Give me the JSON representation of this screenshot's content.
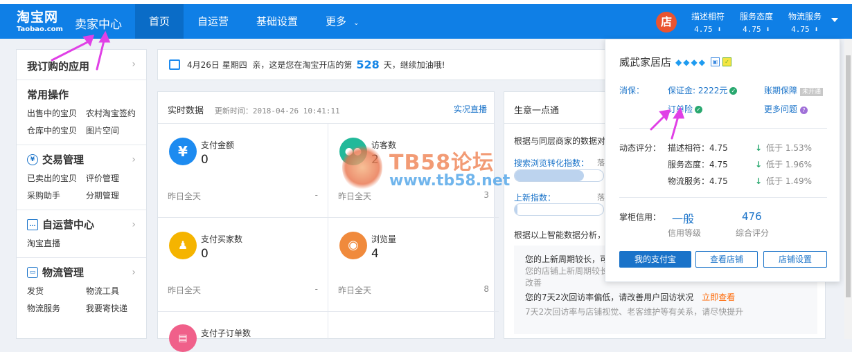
{
  "header": {
    "logo_main": "淘宝网",
    "logo_sub": "Taobao.com",
    "seller_center": "卖家中心",
    "nav": [
      "首页",
      "自运营",
      "基础设置",
      "更多"
    ],
    "shop_avatar": "店",
    "ratings": [
      {
        "label": "描述相符",
        "value": "4.75 ⬇"
      },
      {
        "label": "服务态度",
        "value": "4.75 ⬇"
      },
      {
        "label": "物流服务",
        "value": "4.75 ⬇"
      }
    ]
  },
  "sidebar": {
    "my_apps": "我订购的应用",
    "common_ops": {
      "title": "常用操作",
      "links": [
        "出售中的宝贝",
        "农村淘宝签约",
        "仓库中的宝贝",
        "图片空间"
      ]
    },
    "trade": {
      "title": "交易管理",
      "links": [
        "已卖出的宝贝",
        "评价管理",
        "采购助手",
        "分期管理"
      ]
    },
    "self_ops": {
      "title": "自运营中心",
      "links": [
        "淘宝直播"
      ]
    },
    "logistics": {
      "title": "物流管理",
      "links": [
        "发货",
        "物流工具",
        "物流服务",
        "我要寄快递"
      ]
    }
  },
  "notice": {
    "date": "4月26日 星期四",
    "text_before": "亲，这是您在淘宝开店的第",
    "days": "528",
    "text_after": "天，继续加油哦!"
  },
  "realtime": {
    "title": "实时数据",
    "update_time": "更新时间：2018-04-26 10:41:11",
    "live_link": "实况直播",
    "yesterday_label": "昨日全天",
    "cards": [
      {
        "label": "支付金额",
        "value": "0",
        "yesterday": "-",
        "icon": "¥",
        "color": "#1d8bf0"
      },
      {
        "label": "访客数",
        "value": "2",
        "yesterday": "3",
        "icon": "visitors-icon",
        "color": "#22b99a"
      },
      {
        "label": "支付买家数",
        "value": "0",
        "yesterday": "-",
        "icon": "buyer-icon",
        "color": "#f5b400"
      },
      {
        "label": "浏览量",
        "value": "4",
        "yesterday": "8",
        "icon": "eye-icon",
        "color": "#f08a3c"
      },
      {
        "label": "支付子订单数",
        "value": "",
        "yesterday": "",
        "icon": "order-icon",
        "color": "#f0608a"
      }
    ]
  },
  "business": {
    "title": "生意一点通",
    "compare_text": "根据与同层商家的数据对",
    "search_index": "搜索浏览转化指数：",
    "new_index": "上新指数：",
    "bar_tag": "落",
    "search_level": 0.78,
    "new_level": 0.03,
    "advice_text": "根据以上智能数据分析，",
    "tips": [
      "您的上新周期较长，可",
      "您的店铺上新周期较长",
      "改善",
      "您的7天2次回访率偏低，请改善用户回访状况",
      "立即查看",
      "7天2次回访率与店铺视觉、老客维护等有关系，请尽快提升"
    ]
  },
  "popup": {
    "shop_name": "威武家居店",
    "consumer_protection": "消保：",
    "deposit": "保证金: 2222元",
    "account_guarantee": "账期保障",
    "not_open": "未开通",
    "order_insurance": "订单险",
    "more_questions": "更多问题",
    "dynamic_score_label": "动态评分：",
    "scores": [
      {
        "label": "描述相符：4.75",
        "compare": "低于 1.53%"
      },
      {
        "label": "服务态度：4.75",
        "compare": "低于 1.96%"
      },
      {
        "label": "物流服务：4.75",
        "compare": "低于 1.49%"
      }
    ],
    "credit_label": "掌柜信用：",
    "credit_level": "一般",
    "credit_level_caption": "信用等级",
    "total_score": "476",
    "total_score_caption": "综合评分",
    "buttons": [
      "我的支付宝",
      "查看店铺",
      "店铺设置"
    ]
  },
  "watermark": {
    "title": "TB58论坛",
    "url": "www.tb58.net"
  },
  "colors": {
    "brand_blue": "#0f7fe6",
    "link_blue": "#1a73c9",
    "annotation_magenta": "#e040e6"
  }
}
